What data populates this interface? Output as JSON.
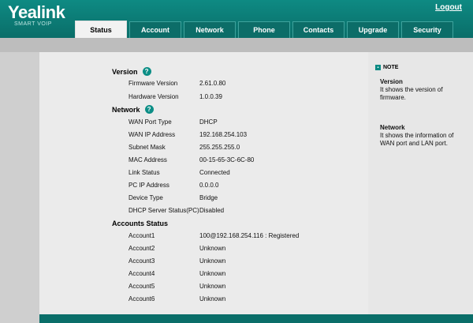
{
  "brand": {
    "name": "Yealink",
    "tagline": "SMART VOIP"
  },
  "logout_label": "Logout",
  "tabs": [
    {
      "label": "Status",
      "active": true
    },
    {
      "label": "Account"
    },
    {
      "label": "Network"
    },
    {
      "label": "Phone"
    },
    {
      "label": "Contacts"
    },
    {
      "label": "Upgrade"
    },
    {
      "label": "Security"
    }
  ],
  "version": {
    "title": "Version",
    "rows": [
      {
        "key": "Firmware Version",
        "value": "2.61.0.80"
      },
      {
        "key": "Hardware Version",
        "value": "1.0.0.39"
      }
    ]
  },
  "network": {
    "title": "Network",
    "rows": [
      {
        "key": "WAN Port Type",
        "value": "DHCP"
      },
      {
        "key": "WAN IP Address",
        "value": "192.168.254.103"
      },
      {
        "key": "Subnet Mask",
        "value": "255.255.255.0"
      },
      {
        "key": "MAC Address",
        "value": "00-15-65-3C-6C-80"
      },
      {
        "key": "Link Status",
        "value": "Connected"
      },
      {
        "key": "PC IP Address",
        "value": "0.0.0.0"
      },
      {
        "key": "Device Type",
        "value": "Bridge"
      },
      {
        "key": "DHCP Server Status(PC)",
        "value": "Disabled"
      }
    ]
  },
  "accounts": {
    "title": "Accounts Status",
    "rows": [
      {
        "key": "Account1",
        "value": "100@192.168.254.116 : Registered"
      },
      {
        "key": "Account2",
        "value": "Unknown"
      },
      {
        "key": "Account3",
        "value": "Unknown"
      },
      {
        "key": "Account4",
        "value": "Unknown"
      },
      {
        "key": "Account5",
        "value": "Unknown"
      },
      {
        "key": "Account6",
        "value": "Unknown"
      }
    ]
  },
  "note": {
    "title": "NOTE",
    "blocks": [
      {
        "title": "Version",
        "text": "It shows the version of firmware."
      },
      {
        "title": "Network",
        "text": "It shows the information of WAN port and LAN port."
      }
    ]
  },
  "colors": {
    "brand": "#0a6e69",
    "help_icon": "#0c8e86"
  }
}
